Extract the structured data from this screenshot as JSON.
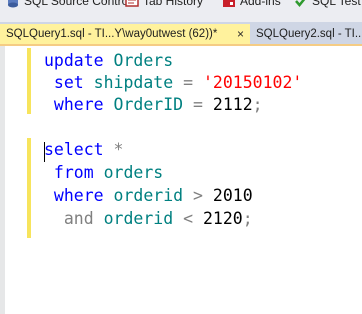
{
  "toolbar": {
    "items": [
      {
        "label": "SQL Source Control",
        "icon": "source-control-icon"
      },
      {
        "label": "Tab History",
        "icon": "tab-history-icon"
      },
      {
        "label": "Add-ins",
        "icon": "add-ins-icon"
      },
      {
        "label": "SQL Test",
        "icon": "sql-test-icon"
      }
    ]
  },
  "tabs": {
    "active": {
      "label": "SQLQuery1.sql - TI...Y\\way0utwest (62))*",
      "close": "×"
    },
    "inactive": {
      "label": "SQLQuery2.sql - TI...\\"
    }
  },
  "editor": {
    "lines": [
      [
        {
          "t": "update",
          "c": "kw"
        },
        {
          "t": " Orders",
          "c": "id"
        }
      ],
      [
        {
          "t": " set",
          "c": "kw"
        },
        {
          "t": " shipdate",
          "c": "id"
        },
        {
          "t": " = ",
          "c": "op"
        },
        {
          "t": "'20150102'",
          "c": "str"
        }
      ],
      [
        {
          "t": " where",
          "c": "kw"
        },
        {
          "t": " OrderID",
          "c": "id"
        },
        {
          "t": " = ",
          "c": "op"
        },
        {
          "t": "2112",
          "c": "num"
        },
        {
          "t": ";",
          "c": "op"
        }
      ],
      [],
      [
        {
          "t": "select",
          "c": "kw"
        },
        {
          "t": " *",
          "c": "op"
        }
      ],
      [
        {
          "t": " from",
          "c": "kw"
        },
        {
          "t": " orders",
          "c": "id"
        }
      ],
      [
        {
          "t": " where",
          "c": "kw"
        },
        {
          "t": " orderid",
          "c": "id"
        },
        {
          "t": " > ",
          "c": "op"
        },
        {
          "t": "2010",
          "c": "num"
        }
      ],
      [
        {
          "t": "  and",
          "c": "op"
        },
        {
          "t": " orderid",
          "c": "id"
        },
        {
          "t": " < ",
          "c": "op"
        },
        {
          "t": "2120",
          "c": "num"
        },
        {
          "t": ";",
          "c": "op"
        }
      ]
    ]
  },
  "colors": {
    "keyword": "#0000ff",
    "identifier": "#008080",
    "string": "#ff0000",
    "operator": "#808080",
    "active_tab": "#fff29d",
    "change_bar": "#f7e45c"
  }
}
